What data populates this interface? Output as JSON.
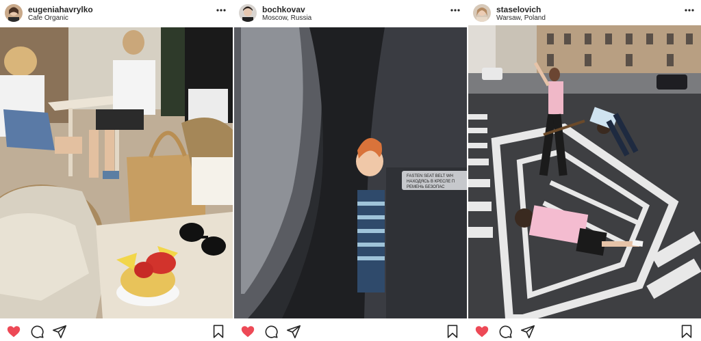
{
  "posts": [
    {
      "username": "eugeniahavrylko",
      "location": "Cafe Organic",
      "liked": true,
      "icons": {
        "like": "heart-filled-icon",
        "comment": "comment-icon",
        "share": "share-icon",
        "save": "bookmark-icon",
        "more": "more-icon"
      }
    },
    {
      "username": "bochkovav",
      "location": "Moscow, Russia",
      "liked": true,
      "sign_text": [
        "FASTEN SEAT BELT WH",
        "НАХОДЯСЬ В КРЕСЛЕ П",
        "РЕМЕНЬ БЕЗОПАС"
      ],
      "icons": {
        "like": "heart-filled-icon",
        "comment": "comment-icon",
        "share": "share-icon",
        "save": "bookmark-icon",
        "more": "more-icon"
      }
    },
    {
      "username": "staselovich",
      "location": "Warsaw, Poland",
      "liked": true,
      "icons": {
        "like": "heart-filled-icon",
        "comment": "comment-icon",
        "share": "share-icon",
        "save": "bookmark-icon",
        "more": "more-icon"
      }
    }
  ],
  "colors": {
    "like": "#ed4956",
    "text": "#262626",
    "background": "#ffffff"
  }
}
